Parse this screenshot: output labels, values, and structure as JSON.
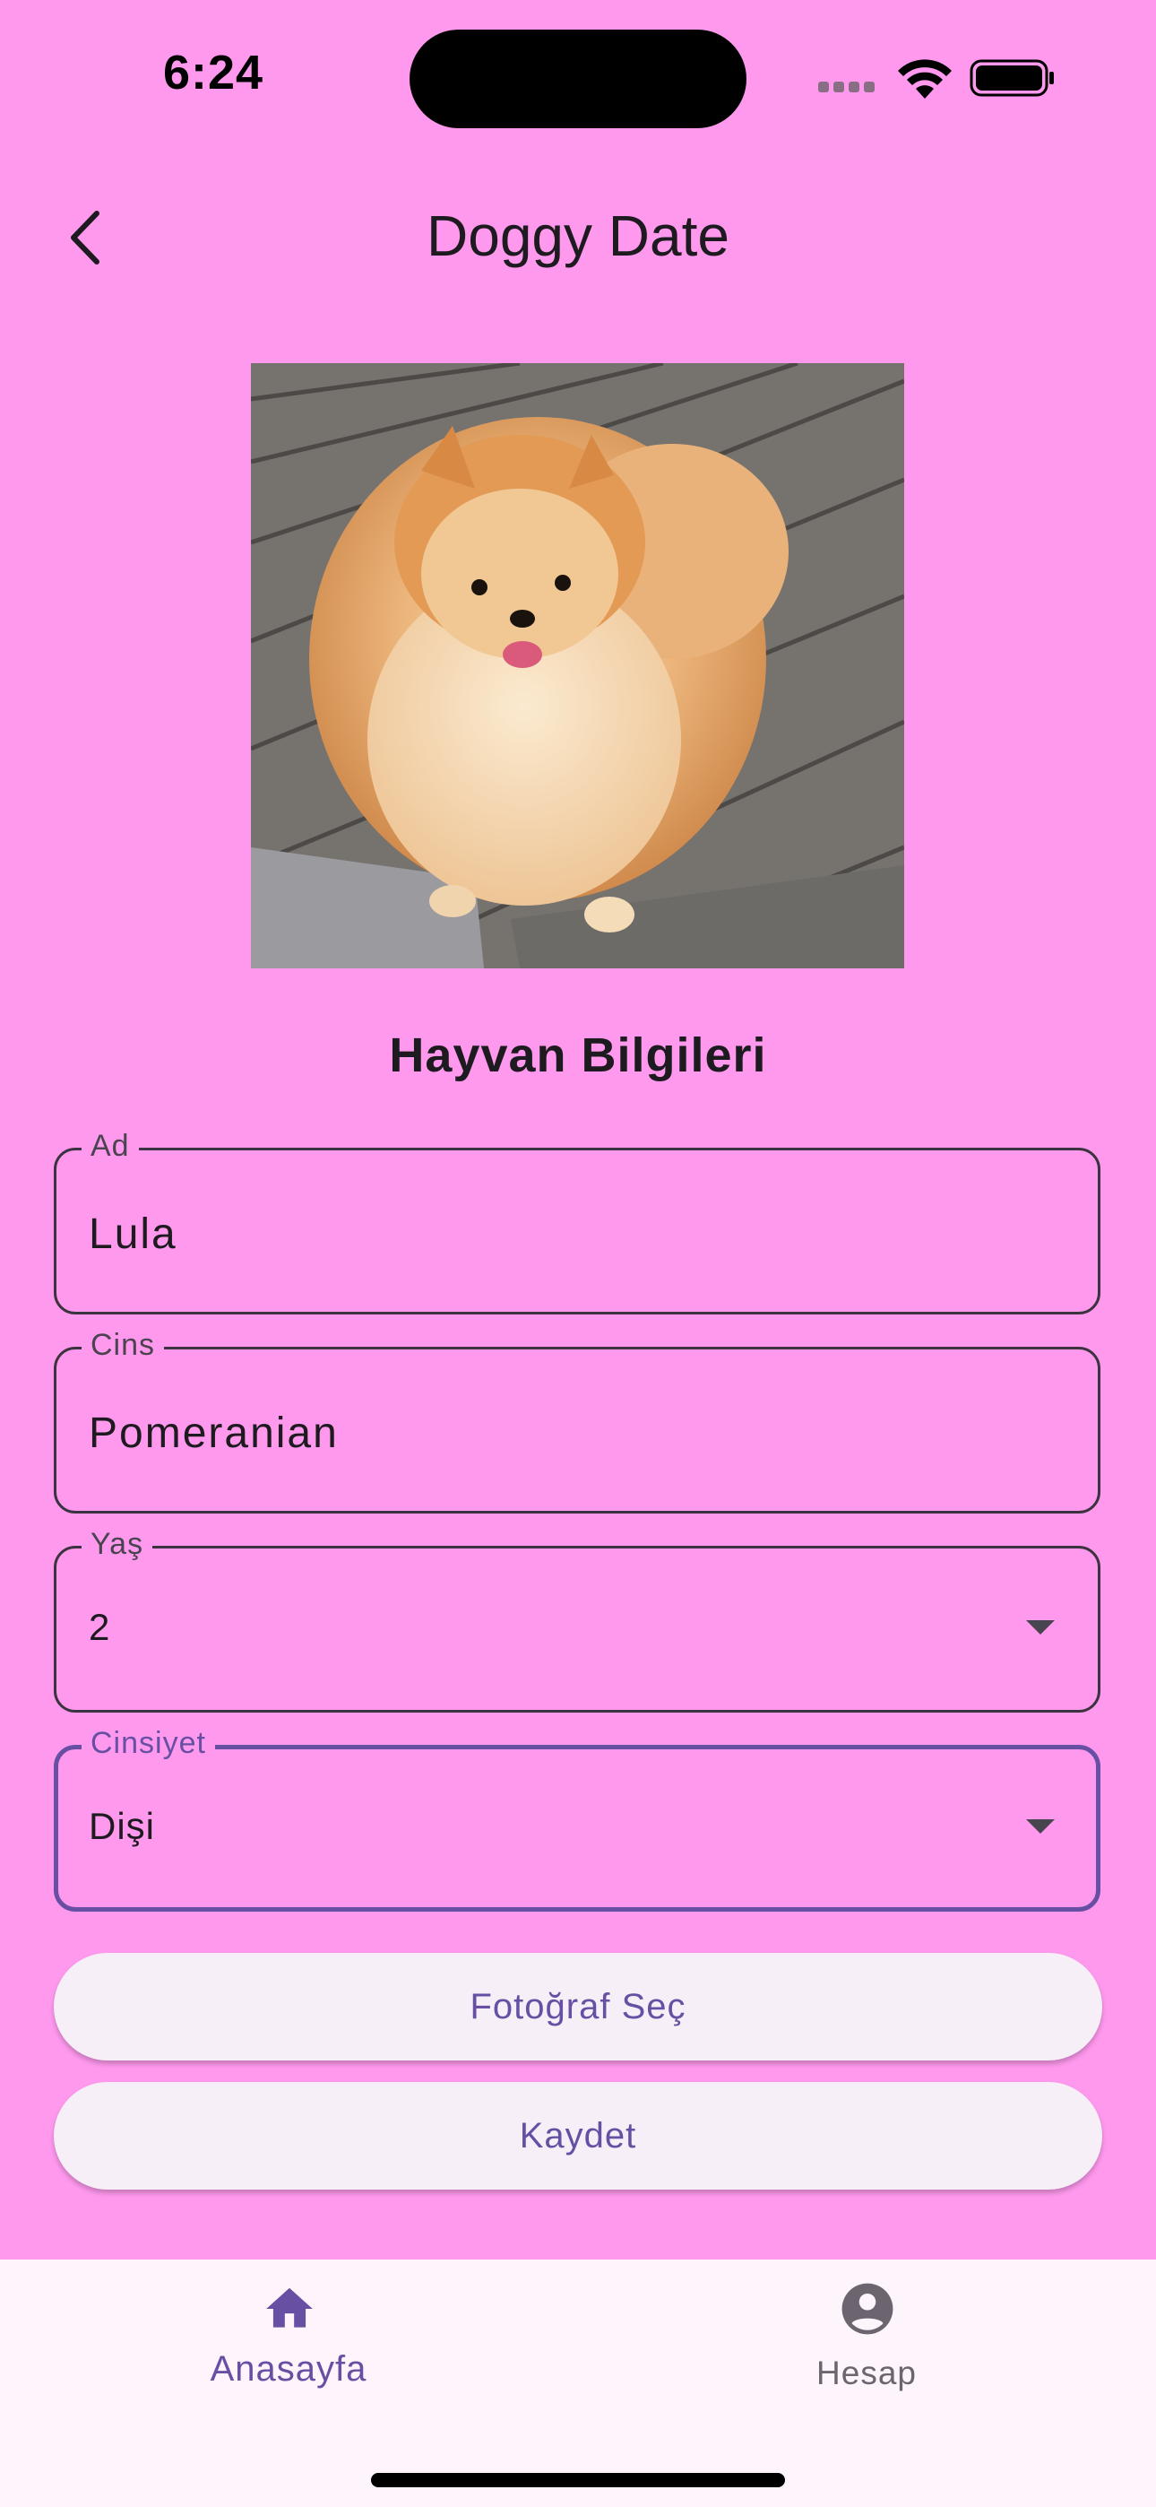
{
  "status_bar": {
    "time": "6:24"
  },
  "app_bar": {
    "title": "Doggy Date"
  },
  "photo": {
    "subject": "Pomeranian dog on wooden deck"
  },
  "form": {
    "section_title": "Hayvan Bilgileri",
    "name": {
      "label": "Ad",
      "value": "Lula"
    },
    "breed": {
      "label": "Cins",
      "value": "Pomeranian"
    },
    "age": {
      "label": "Yaş",
      "value": "2"
    },
    "gender": {
      "label": "Cinsiyet",
      "value": "Dişi"
    }
  },
  "buttons": {
    "choose_photo": "Fotoğraf Seç",
    "save": "Kaydet"
  },
  "bottom_nav": {
    "items": [
      {
        "label": "Anasayfa",
        "icon": "home-icon",
        "selected": true
      },
      {
        "label": "Hesap",
        "icon": "account-circle-icon",
        "selected": false
      }
    ]
  },
  "colors": {
    "background": "#ff99ee",
    "accent": "#6750a4",
    "button_bg": "#f6eff7",
    "nav_bg": "#fdf5fb"
  }
}
